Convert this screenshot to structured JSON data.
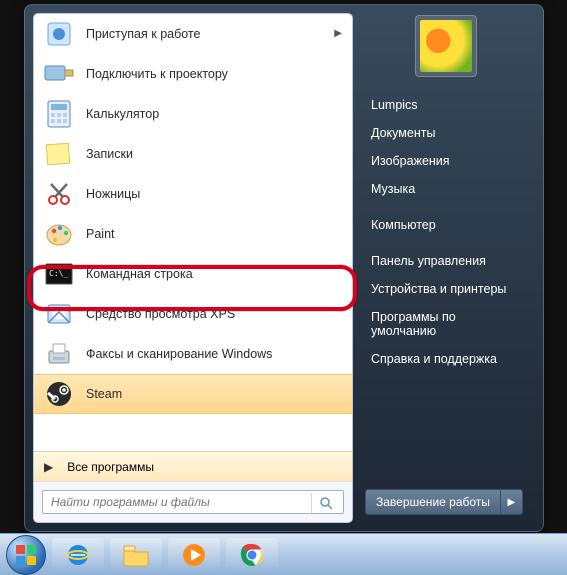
{
  "programs": [
    {
      "label": "Приступая к работе",
      "icon": "gettingstarted",
      "expand": true
    },
    {
      "label": "Подключить к проектору",
      "icon": "projector"
    },
    {
      "label": "Калькулятор",
      "icon": "calculator"
    },
    {
      "label": "Записки",
      "icon": "stickynotes"
    },
    {
      "label": "Ножницы",
      "icon": "snipping"
    },
    {
      "label": "Paint",
      "icon": "paint"
    },
    {
      "label": "Командная строка",
      "icon": "cmd",
      "highlighted": true
    },
    {
      "label": "Средство просмотра XPS",
      "icon": "xps"
    },
    {
      "label": "Факсы и сканирование Windows",
      "icon": "faxscan"
    },
    {
      "label": "Steam",
      "icon": "steam",
      "steam": true
    }
  ],
  "all_programs_label": "Все программы",
  "search_placeholder": "Найти программы и файлы",
  "right_links": {
    "group1": [
      "Lumpics",
      "Документы",
      "Изображения",
      "Музыка"
    ],
    "group2": [
      "Компьютер"
    ],
    "group3": [
      "Панель управления",
      "Устройства и принтеры",
      "Программы по умолчанию",
      "Справка и поддержка"
    ]
  },
  "shutdown_label": "Завершение работы",
  "taskbar": [
    "start",
    "ie",
    "explorer",
    "wmp",
    "chrome"
  ]
}
